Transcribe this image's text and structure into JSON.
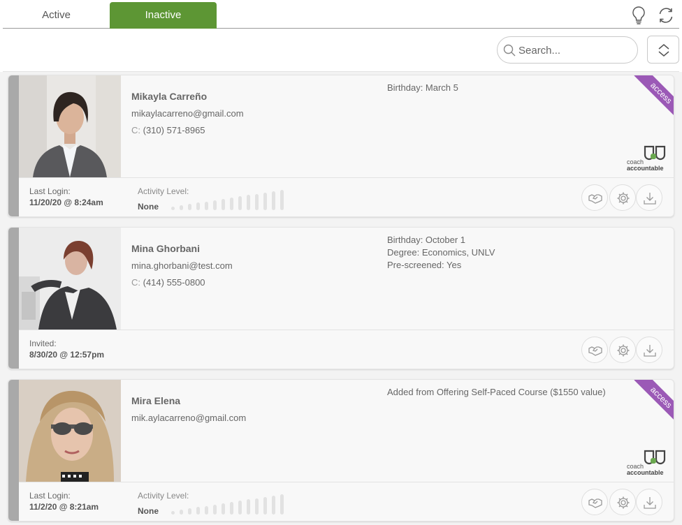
{
  "tabs": {
    "active_label": "Active",
    "inactive_label": "Inactive",
    "selected": "Inactive"
  },
  "toolbar": {
    "search_placeholder": "Search..."
  },
  "colors": {
    "accent": "#5d9634",
    "ribbon": "#9b59b6",
    "stripe": "#a9a9a9"
  },
  "clients": [
    {
      "name": "Mikayla Carreño",
      "email": "mikaylacarreno@gmail.com",
      "phone_prefix": "C:",
      "phone": "(310) 571-8965",
      "info_lines": [
        "Birthday: March 5"
      ],
      "ribbon": "access",
      "logo_text_1": "coach",
      "logo_text_2": "accountable",
      "footer_label": "Last Login:",
      "footer_value": "11/20/20 @ 8:24am",
      "activity_label": "Activity Level:",
      "activity_value": "None"
    },
    {
      "name": "Mina Ghorbani",
      "email": "mina.ghorbani@test.com",
      "phone_prefix": "C:",
      "phone": "(414) 555-0800",
      "info_lines": [
        "Birthday: October 1",
        "Degree: Economics, UNLV",
        "Pre-screened: Yes"
      ],
      "footer_label": "Invited:",
      "footer_value": "8/30/20 @ 12:57pm"
    },
    {
      "name": "Mira Elena",
      "email": "mik.aylacarreno@gmail.com",
      "info_lines": [
        "Added from Offering Self-Paced Course ($1550 value)"
      ],
      "ribbon": "access",
      "logo_text_1": "coach",
      "logo_text_2": "accountable",
      "footer_label": "Last Login:",
      "footer_value": "11/2/20 @ 8:21am",
      "activity_label": "Activity Level:",
      "activity_value": "None"
    }
  ],
  "icons": [
    "lightbulb-icon",
    "refresh-icon",
    "search-icon",
    "sort-toggle-icon",
    "handshake-icon",
    "gear-icon",
    "download-icon"
  ]
}
